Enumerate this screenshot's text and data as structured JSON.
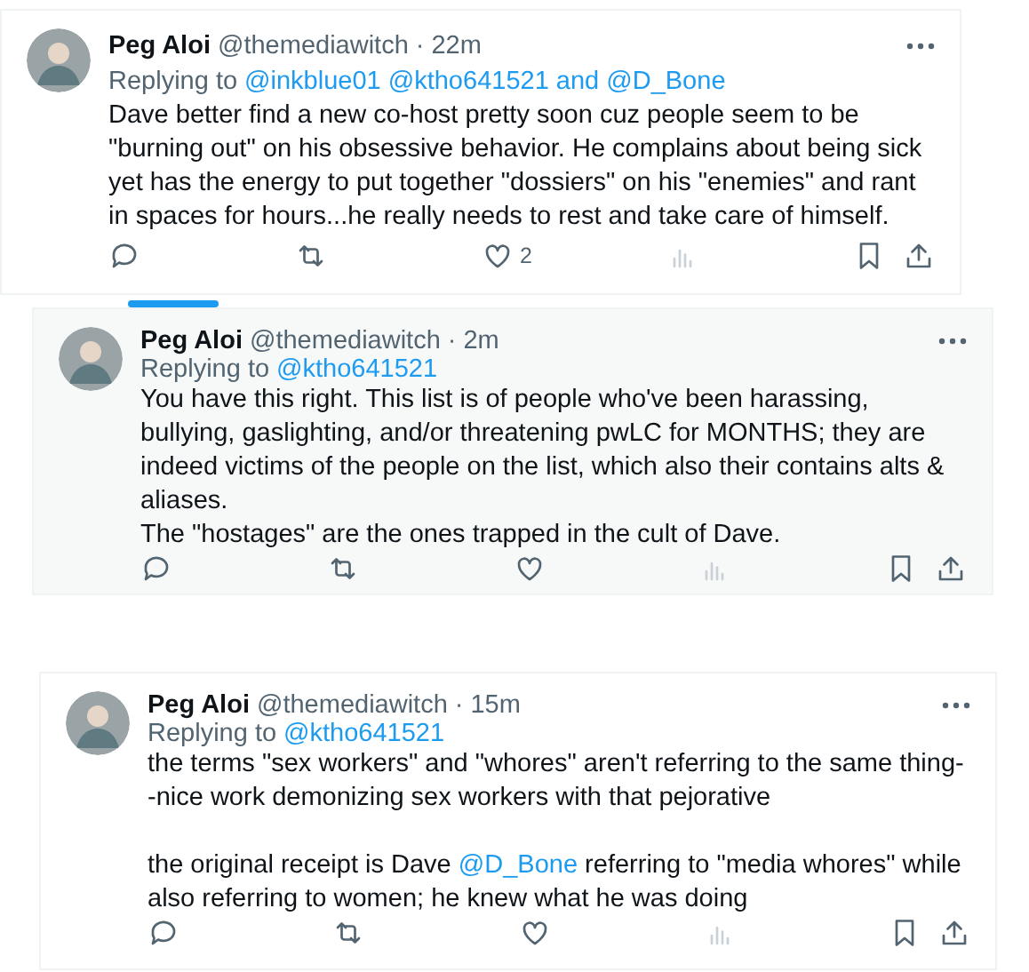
{
  "tweets": [
    {
      "name": "Peg Aloi",
      "handle": "@themediawitch",
      "time": "· 22m",
      "replying_label": "Replying to",
      "replying_targets": "@inkblue01 @ktho641521 and @D_Bone",
      "paragraphs": [
        [
          {
            "kind": "plain",
            "text": "Dave better find a new co-host pretty soon cuz people seem to be \"burning out\" on his obsessive behavior. He complains about being sick yet has the energy to put together \"dossiers\" on his \"enemies\" and rant in spaces for hours...he really needs to rest and take care of himself."
          }
        ]
      ],
      "like_count": "2"
    },
    {
      "name": "Peg Aloi",
      "handle": "@themediawitch",
      "time": "· 2m",
      "replying_label": "Replying to",
      "replying_targets": "@ktho641521",
      "paragraphs": [
        [
          {
            "kind": "plain",
            "text": "You have this right. This list is of people who've been harassing, bullying, gaslighting, and/or threatening pwLC for MONTHS; they are indeed victims of the people on the list, which also their contains alts & aliases."
          }
        ],
        [
          {
            "kind": "plain",
            "text": "The \"hostages\" are the ones trapped in the cult of Dave."
          }
        ]
      ]
    },
    {
      "name": "Peg Aloi",
      "handle": "@themediawitch",
      "time": "· 15m",
      "replying_label": "Replying to",
      "replying_targets": "@ktho641521",
      "paragraphs": [
        [
          {
            "kind": "plain",
            "text": "the terms \"sex workers\" and \"whores\" aren't referring to the same thing--nice work demonizing sex workers with that pejorative"
          }
        ],
        [
          {
            "kind": "plain",
            "text": "the original receipt is Dave "
          },
          {
            "kind": "mention",
            "text": "@D_Bone"
          },
          {
            "kind": "plain",
            "text": " referring to \"media whores\" while also referring to women; he knew what he was doing"
          }
        ]
      ]
    }
  ]
}
